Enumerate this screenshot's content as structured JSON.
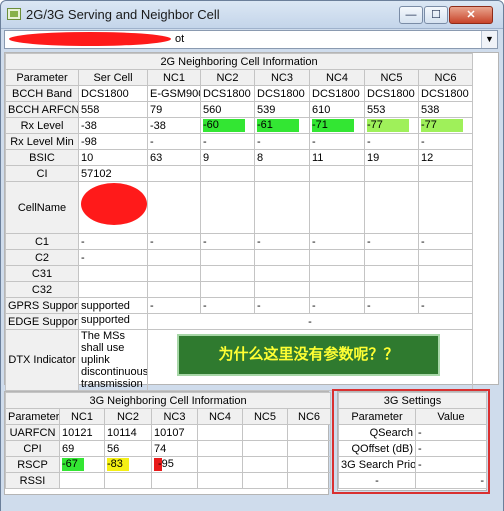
{
  "window": {
    "title": "2G/3G Serving and Neighbor Cell",
    "controls": {
      "minimize": "—",
      "maximize": "☐",
      "close": "✕"
    }
  },
  "selector": {
    "value": "ot"
  },
  "table2g": {
    "title": "2G Neighboring Cell Information",
    "headers": [
      "Parameter",
      "Ser Cell",
      "NC1",
      "NC2",
      "NC3",
      "NC4",
      "NC5",
      "NC6"
    ],
    "rows": [
      {
        "label": "BCCH Band",
        "cells": [
          "DCS1800",
          "E-GSM900",
          "DCS1800",
          "DCS1800",
          "DCS1800",
          "DCS1800",
          "DCS1800"
        ]
      },
      {
        "label": "BCCH ARFCN",
        "cells": [
          "558",
          "79",
          "560",
          "539",
          "610",
          "553",
          "538"
        ]
      },
      {
        "label": "Rx Level",
        "cells": [
          "-38",
          "-38",
          "-60",
          "-61",
          "-71",
          "-77",
          "-77"
        ]
      },
      {
        "label": "Rx Level Min",
        "cells": [
          "-98",
          "-",
          "-",
          "-",
          "-",
          "-",
          "-"
        ]
      },
      {
        "label": "BSIC",
        "cells": [
          "10",
          "63",
          "9",
          "8",
          "11",
          "19",
          "12"
        ]
      },
      {
        "label": "CI",
        "cells": [
          "57102",
          "",
          "",
          "",
          "",
          "",
          ""
        ]
      },
      {
        "label": "CellName",
        "cells": [
          "",
          "",
          "",
          "",
          "",
          "",
          ""
        ]
      },
      {
        "label": "C1",
        "cells": [
          "-",
          "-",
          "-",
          "-",
          "-",
          "-",
          "-"
        ]
      },
      {
        "label": "C2",
        "cells": [
          "-",
          "",
          "",
          "",
          "",
          "",
          ""
        ]
      },
      {
        "label": "C31",
        "cells": [
          "",
          "",
          "",
          "",
          "",
          "",
          ""
        ]
      },
      {
        "label": "C32",
        "cells": [
          "",
          "",
          "",
          "",
          "",
          "",
          ""
        ]
      },
      {
        "label": "GPRS Support",
        "cells": [
          "supported",
          "-",
          "-",
          "-",
          "-",
          "-",
          "-"
        ]
      },
      {
        "label": "EDGE Support",
        "ser": "supported",
        "span": "-"
      },
      {
        "label": "DTX Indicator",
        "ser": "The MSs shall use uplink discontinuous transmission"
      }
    ],
    "rx_colors": [
      "#33e633",
      "#33e633",
      "#33e633",
      "#9ff05a",
      "#9ff05a"
    ]
  },
  "annotation": "为什么这里没有参数呢？？",
  "table3g": {
    "title": "3G Neighboring Cell Information",
    "headers": [
      "Parameter",
      "NC1",
      "NC2",
      "NC3",
      "NC4",
      "NC5",
      "NC6"
    ],
    "rows": [
      {
        "label": "UARFCN",
        "cells": [
          "10121",
          "10114",
          "10107",
          "",
          "",
          ""
        ]
      },
      {
        "label": "CPI",
        "cells": [
          "69",
          "56",
          "74",
          "",
          "",
          ""
        ]
      },
      {
        "label": "RSCP",
        "cells": [
          "-67",
          "-83",
          "-95",
          "",
          "",
          ""
        ]
      },
      {
        "label": "RSSI",
        "cells": [
          "",
          "",
          "",
          "",
          "",
          ""
        ]
      }
    ],
    "rscp_colors": [
      "#33e633",
      "#f5f014",
      "#e81a1a"
    ]
  },
  "settings3g": {
    "title": "3G Settings",
    "headers": [
      "Parameter",
      "Value"
    ],
    "rows": [
      {
        "label": "QSearch",
        "value": "-"
      },
      {
        "label": "QOffset (dB)",
        "value": "-"
      },
      {
        "label": "3G Search Prio",
        "value": "-"
      },
      {
        "label": "-",
        "value": "-"
      }
    ]
  }
}
